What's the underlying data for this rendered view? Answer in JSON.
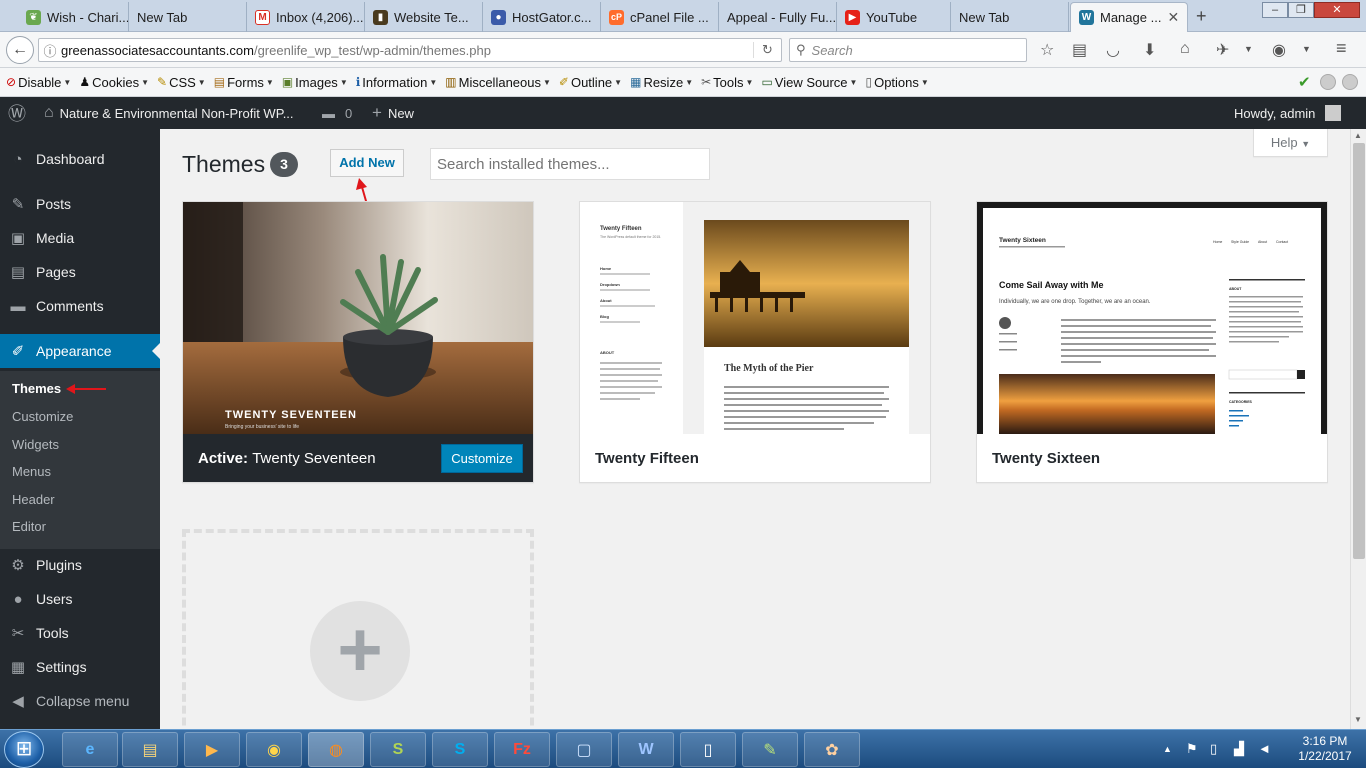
{
  "browser": {
    "tabs": [
      {
        "label": "Wish - Chari...",
        "favicon": "leaf-icon",
        "color": "#6aa84f"
      },
      {
        "label": "New Tab",
        "favicon": "",
        "color": ""
      },
      {
        "label": "Inbox (4,206)...",
        "favicon": "gmail-icon",
        "color": "#d93025"
      },
      {
        "label": "Website Te...",
        "favicon": "book-icon",
        "color": "#4a3b1f"
      },
      {
        "label": "HostGator.c...",
        "favicon": "gator-icon",
        "color": "#3b5ba9"
      },
      {
        "label": "cPanel File ...",
        "favicon": "cpanel-icon",
        "color": "#ff6c2c"
      },
      {
        "label": "Appeal - Fully Fu...",
        "favicon": "",
        "color": ""
      },
      {
        "label": "YouTube",
        "favicon": "youtube-icon",
        "color": "#e62117"
      },
      {
        "label": "New Tab",
        "favicon": "",
        "color": ""
      },
      {
        "label": "Manage ...",
        "favicon": "wordpress-icon",
        "color": "#21759b"
      }
    ],
    "url_domain": "greenassociatesaccountants.com",
    "url_path": "/greenlife_wp_test/wp-admin/themes.php",
    "search_placeholder": "Search"
  },
  "devtoolbar": [
    {
      "label": "Disable",
      "glyph": "⊘"
    },
    {
      "label": "Cookies",
      "glyph": "♟"
    },
    {
      "label": "CSS",
      "glyph": "✎"
    },
    {
      "label": "Forms",
      "glyph": "▤"
    },
    {
      "label": "Images",
      "glyph": "▣"
    },
    {
      "label": "Information",
      "glyph": "ℹ"
    },
    {
      "label": "Miscellaneous",
      "glyph": "▥"
    },
    {
      "label": "Outline",
      "glyph": "✐"
    },
    {
      "label": "Resize",
      "glyph": "▦"
    },
    {
      "label": "Tools",
      "glyph": "✂"
    },
    {
      "label": "View Source",
      "glyph": "▭"
    },
    {
      "label": "Options",
      "glyph": "▯"
    }
  ],
  "adminbar": {
    "site_name": "Nature & Environmental Non-Profit WP...",
    "comments_count": "0",
    "new_label": "New",
    "howdy": "Howdy, admin"
  },
  "sidebar": {
    "items": [
      {
        "label": "Dashboard",
        "icon": "dashboard-icon",
        "glyph": "◔"
      },
      {
        "label": "Posts",
        "icon": "pin-icon",
        "glyph": "✎"
      },
      {
        "label": "Media",
        "icon": "media-icon",
        "glyph": "▣"
      },
      {
        "label": "Pages",
        "icon": "pages-icon",
        "glyph": "▤"
      },
      {
        "label": "Comments",
        "icon": "comments-icon",
        "glyph": "▬"
      },
      {
        "label": "Appearance",
        "icon": "brush-icon",
        "glyph": "✐"
      },
      {
        "label": "Plugins",
        "icon": "plugin-icon",
        "glyph": "⚙"
      },
      {
        "label": "Users",
        "icon": "user-icon",
        "glyph": "●"
      },
      {
        "label": "Tools",
        "icon": "wrench-icon",
        "glyph": "✂"
      },
      {
        "label": "Settings",
        "icon": "settings-icon",
        "glyph": "▦"
      },
      {
        "label": "Collapse menu",
        "icon": "collapse-icon",
        "glyph": "◀"
      }
    ],
    "submenu": [
      "Themes",
      "Customize",
      "Widgets",
      "Menus",
      "Header",
      "Editor"
    ]
  },
  "main": {
    "title": "Themes",
    "count": "3",
    "add_new": "Add New",
    "search_placeholder": "Search installed themes...",
    "help": "Help"
  },
  "themes": [
    {
      "active_prefix": "Active:",
      "name": "Twenty Seventeen",
      "customize": "Customize",
      "shot_title": "TWENTY SEVENTEEN",
      "shot_tagline": "Bringing your business' site to life"
    },
    {
      "name": "Twenty Fifteen",
      "shot_site": "Twenty Fifteen",
      "shot_desc": "The WordPress default theme for 2015.",
      "shot_nav": [
        "Home",
        "Dropdown",
        "About",
        "Blog"
      ],
      "shot_about": "ABOUT",
      "shot_post_title": "The Myth of the Pier"
    },
    {
      "name": "Twenty Sixteen",
      "shot_site": "Twenty Sixteen",
      "shot_nav": [
        "Home",
        "Style Guide",
        "About",
        "Contact"
      ],
      "shot_post_title": "Come Sail Away with Me",
      "shot_excerpt": "Individually, we are one drop. Together, we are an ocean.",
      "shot_about": "ABOUT",
      "shot_categories": "CATEGORIES"
    }
  ],
  "taskbar": {
    "apps": [
      "e",
      "▤",
      "▶",
      "◉",
      "◍",
      "S",
      "S",
      "Fz",
      "▢",
      "W",
      "▯",
      "✎",
      "✿"
    ],
    "time": "3:16 PM",
    "date": "1/22/2017"
  },
  "colors": {
    "wp_blue": "#0073aa",
    "admin_dark": "#23282d",
    "customize_blue": "#0085ba",
    "annotation_red": "#e0161b"
  }
}
